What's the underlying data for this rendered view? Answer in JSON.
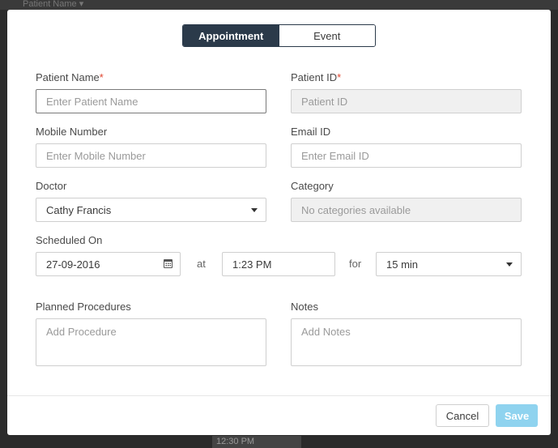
{
  "background": {
    "top_text": "Patient Name ▾",
    "bottom_text": "12:30 PM"
  },
  "tabs": {
    "appointment": "Appointment",
    "event": "Event"
  },
  "form": {
    "patient_name": {
      "label": "Patient Name",
      "required": "*",
      "placeholder": "Enter Patient Name",
      "value": ""
    },
    "patient_id": {
      "label": "Patient ID",
      "required": "*",
      "placeholder": "Patient ID",
      "value": ""
    },
    "mobile": {
      "label": "Mobile Number",
      "placeholder": "Enter Mobile Number",
      "value": ""
    },
    "email": {
      "label": "Email ID",
      "placeholder": "Enter Email ID",
      "value": ""
    },
    "doctor": {
      "label": "Doctor",
      "value": "Cathy Francis"
    },
    "category": {
      "label": "Category",
      "value": "No categories available"
    },
    "scheduled": {
      "label": "Scheduled On",
      "date": "27-09-2016",
      "at_label": "at",
      "time": "1:23 PM",
      "for_label": "for",
      "duration": "15 min"
    },
    "procedures": {
      "label": "Planned Procedures",
      "placeholder": "Add Procedure",
      "value": ""
    },
    "notes": {
      "label": "Notes",
      "placeholder": "Add Notes",
      "value": ""
    }
  },
  "footer": {
    "cancel": "Cancel",
    "save": "Save"
  },
  "colors": {
    "accent_dark": "#2b3a4a",
    "required": "#e0452f",
    "save_button": "#8fd3ef"
  }
}
